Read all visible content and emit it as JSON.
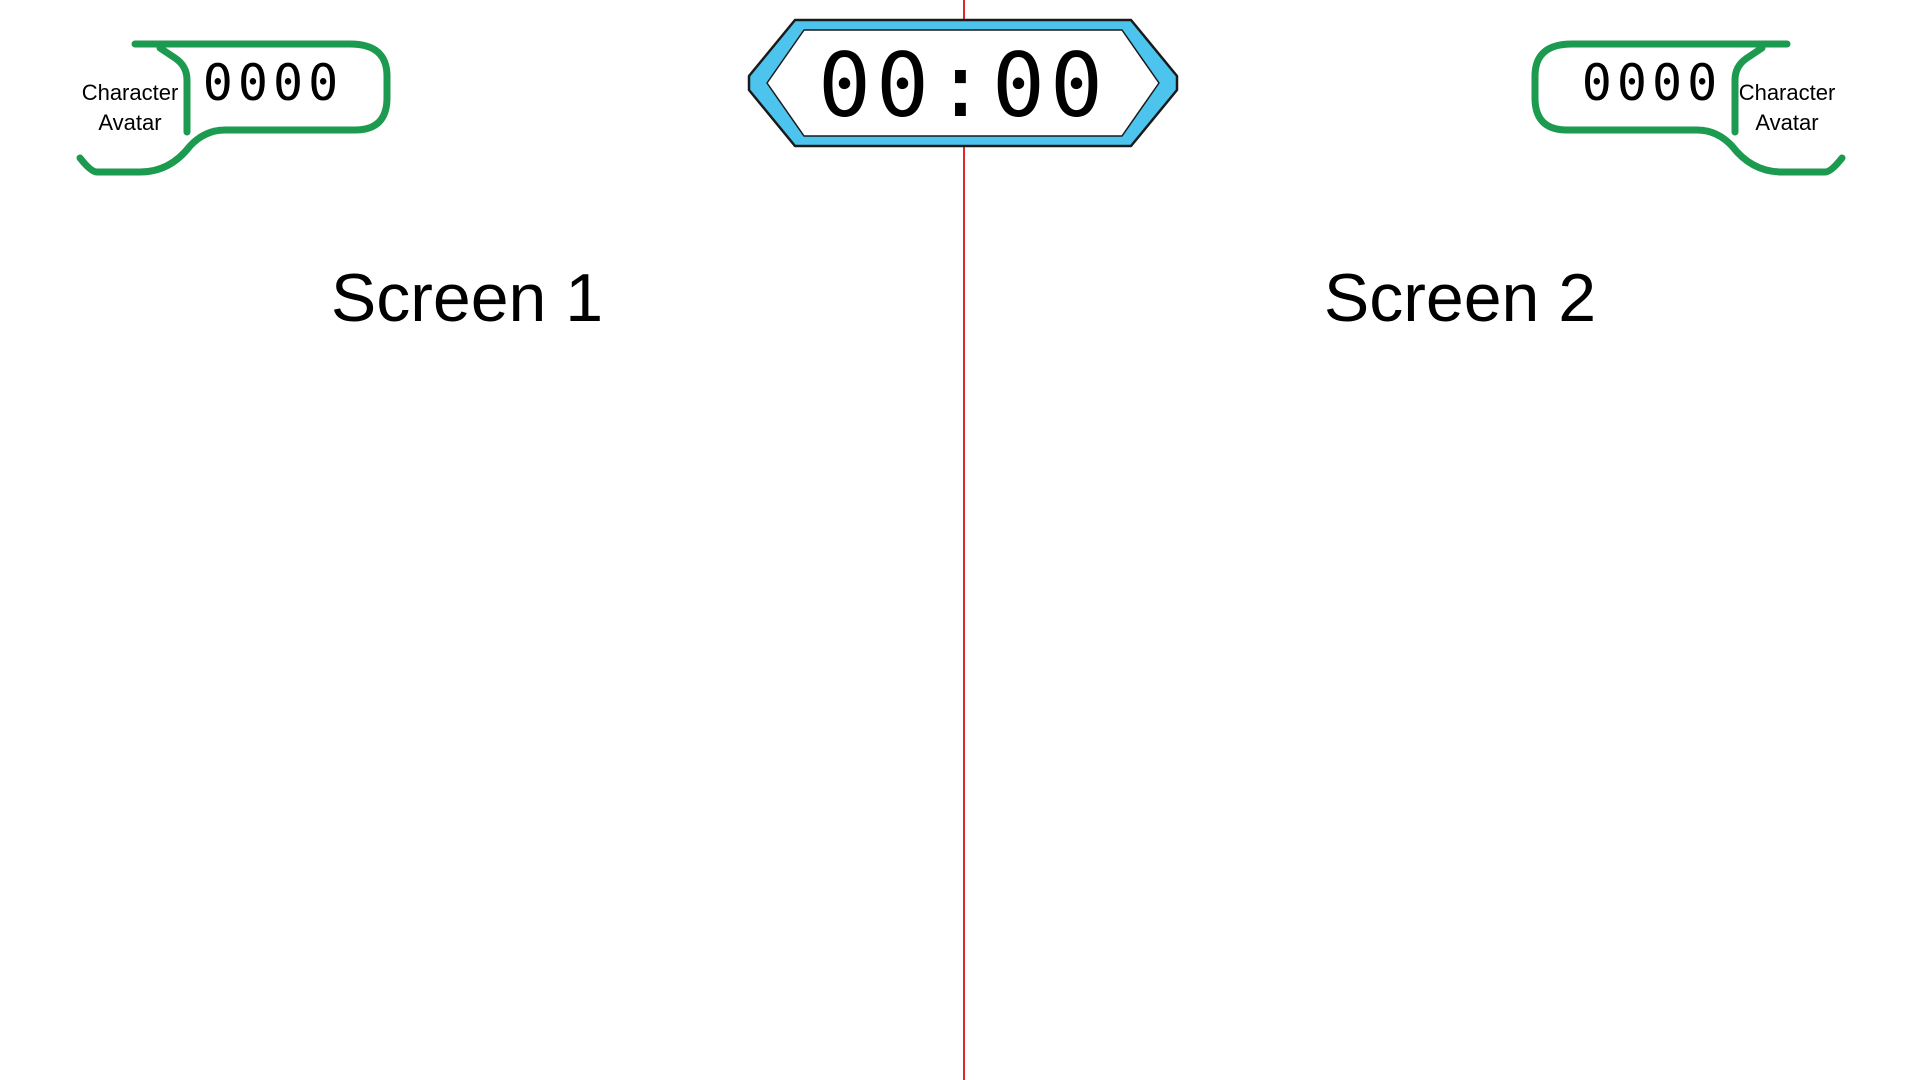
{
  "colors": {
    "divider": "#e1262c",
    "timer_fill": "#4cc4ee",
    "timer_outline": "#1a1a1a",
    "hud_frame": "#1c9a50"
  },
  "timer": {
    "value": "00:00"
  },
  "players": [
    {
      "score": "0000",
      "avatar_line1": "Character",
      "avatar_line2": "Avatar"
    },
    {
      "score": "0000",
      "avatar_line1": "Character",
      "avatar_line2": "Avatar"
    }
  ],
  "screens": [
    {
      "label": "Screen 1"
    },
    {
      "label": "Screen 2"
    }
  ]
}
